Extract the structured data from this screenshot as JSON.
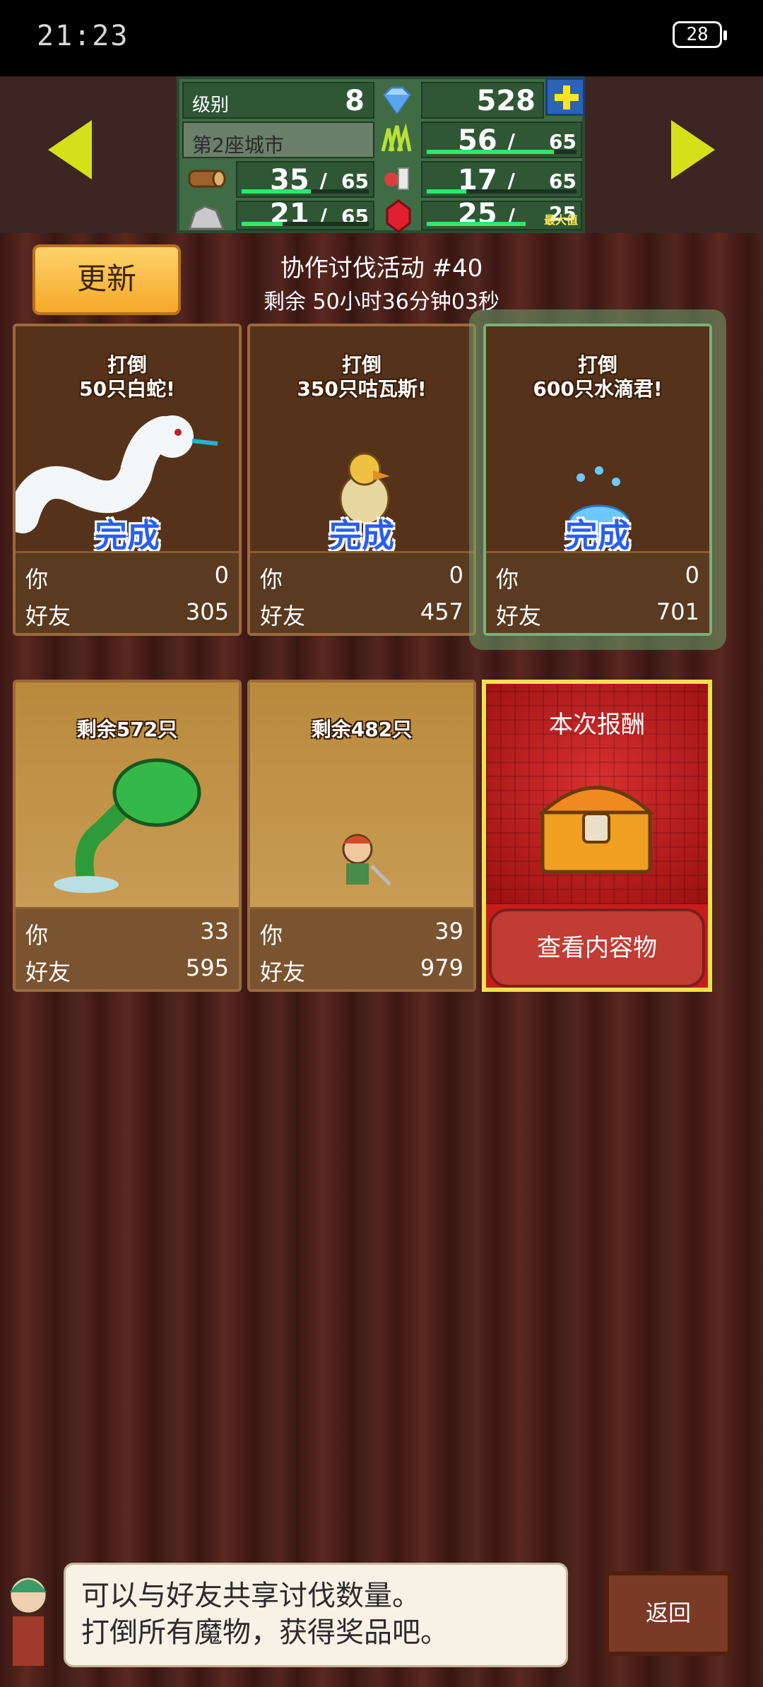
{
  "status_bar": {
    "time": "21:23",
    "battery": "28"
  },
  "resources": {
    "level_label": "级别",
    "level_value": "8",
    "gems": "528",
    "city_name": "第2座城市",
    "grass_value": "56",
    "grass_max": "65",
    "wood_value": "35",
    "wood_max": "65",
    "food_value": "17",
    "food_max": "65",
    "ore_value": "21",
    "ore_max": "65",
    "ruby_value": "25",
    "ruby_max": "25",
    "max_label": "最大值",
    "slash": "/"
  },
  "header": {
    "refresh_label": "更新",
    "event_title": "协作讨伐活动 #40",
    "event_remaining": "剩余 50小时36分钟03秒"
  },
  "labels": {
    "you": "你",
    "friends": "好友",
    "done": "完成"
  },
  "cards": [
    {
      "title_line1": "打倒",
      "title_line2": "50只白蛇!",
      "you": "0",
      "friends": "305"
    },
    {
      "title_line1": "打倒",
      "title_line2": "350只咕瓦斯!",
      "you": "0",
      "friends": "457"
    },
    {
      "title_line1": "打倒",
      "title_line2": "600只水滴君!",
      "you": "0",
      "friends": "701"
    },
    {
      "title_line1": "剩余572只",
      "you": "33",
      "friends": "595"
    },
    {
      "title_line1": "剩余482只",
      "you": "39",
      "friends": "979"
    }
  ],
  "reward": {
    "title": "本次报酬",
    "view_button": "查看内容物"
  },
  "tip": {
    "line1": "可以与好友共享讨伐数量。",
    "line2": "打倒所有魔物，获得奖品吧。"
  },
  "back_button": "返回",
  "colors": {
    "accent_yellow": "#d6e01a",
    "bar_green": "#2de86a",
    "done_blue": "#2a5ef0",
    "reward_red": "#c81c1c"
  }
}
